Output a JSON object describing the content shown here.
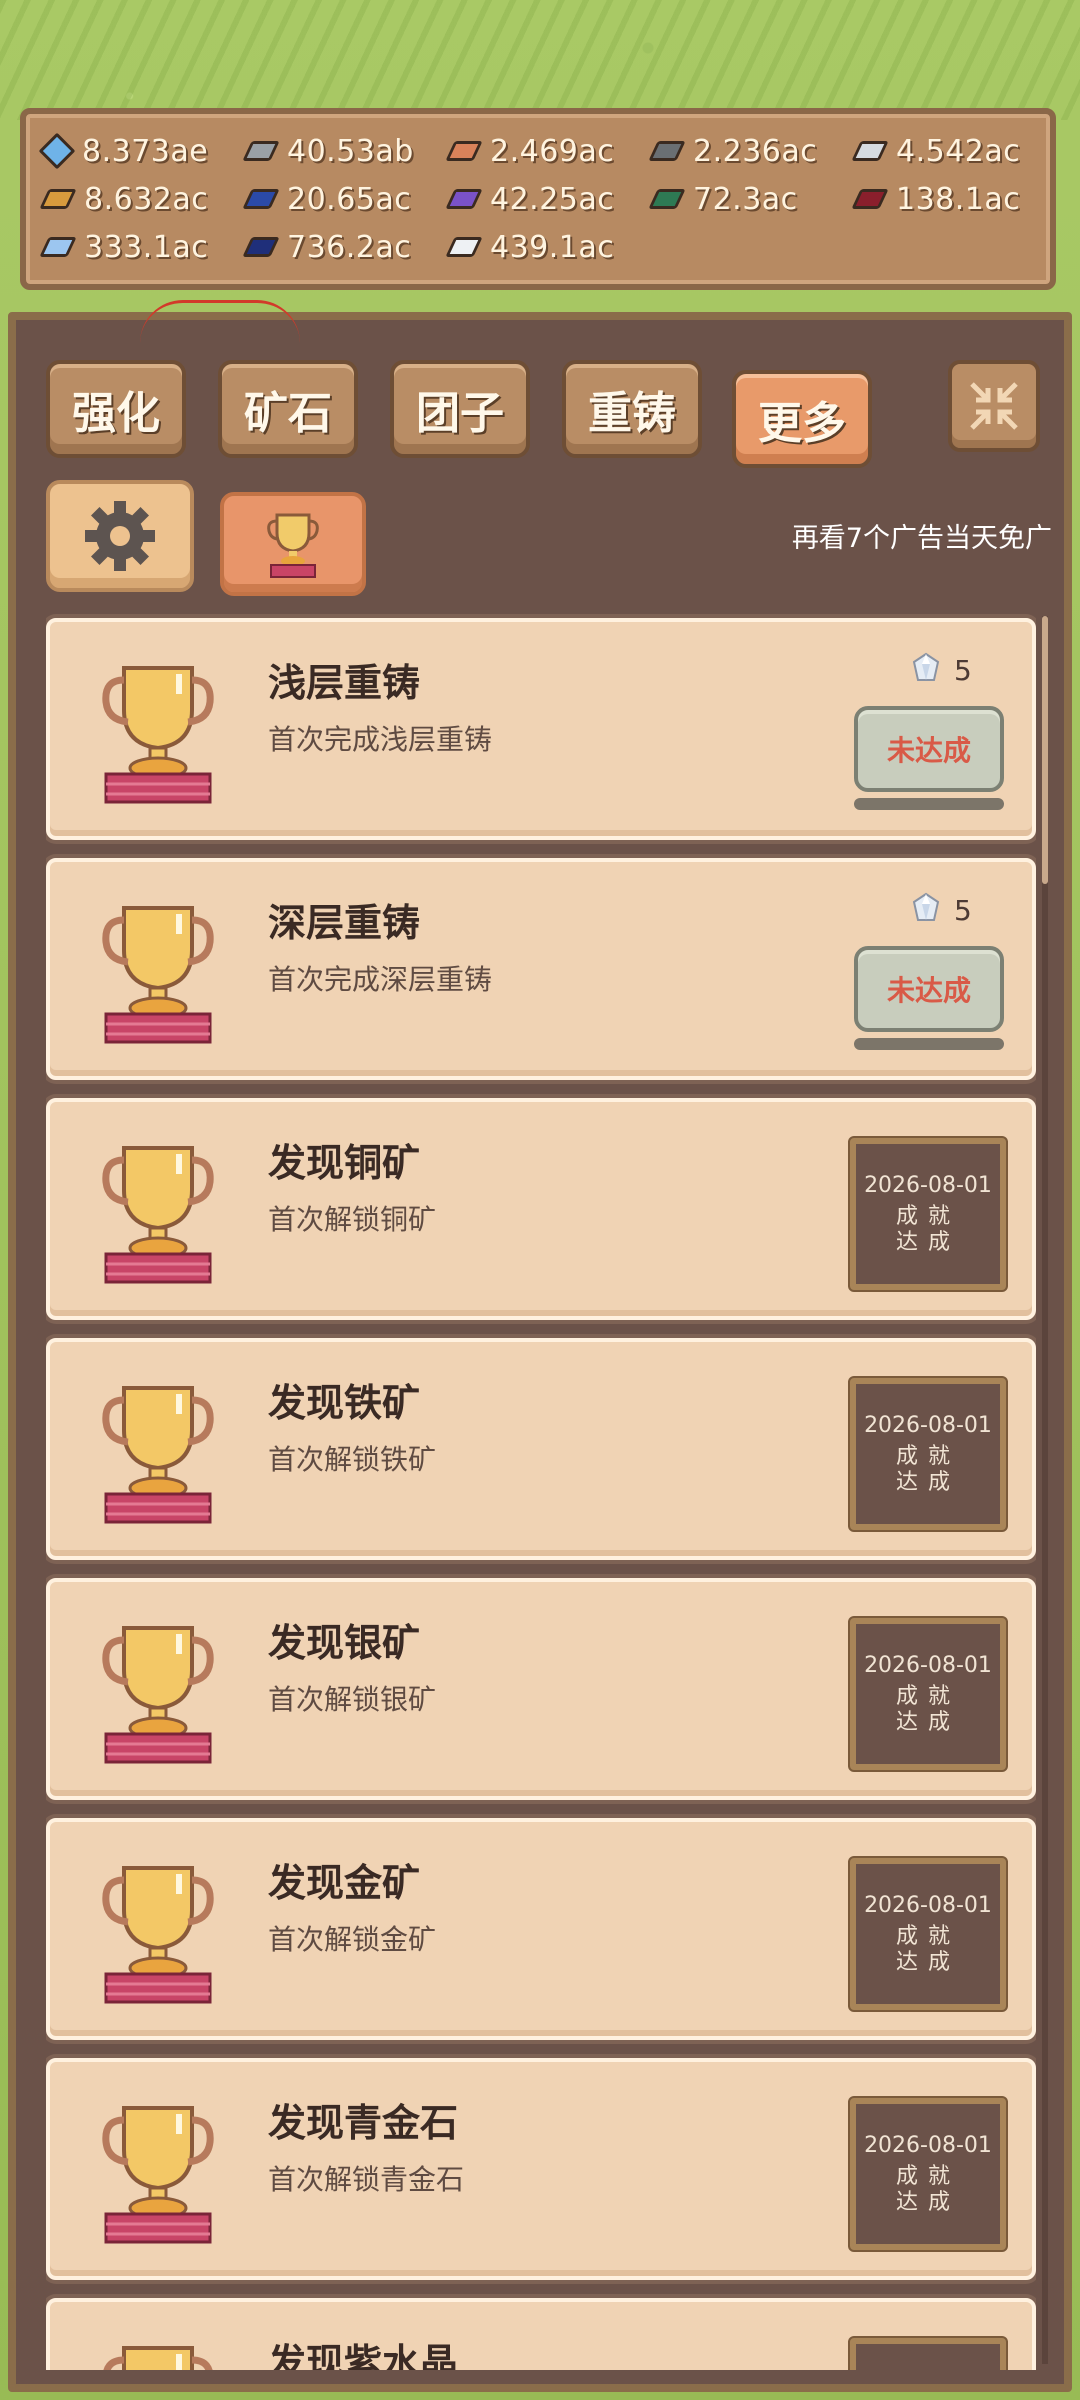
{
  "resources": [
    {
      "value": "8.373ae",
      "icon": "diamond-gem-icon",
      "color": "#6fb3e8"
    },
    {
      "value": "40.53ab",
      "icon": "grey-ore-icon",
      "color": "#9aa0a6"
    },
    {
      "value": "2.469ac",
      "icon": "copper-ore-icon",
      "color": "#d9825a"
    },
    {
      "value": "2.236ac",
      "icon": "iron-ore-icon",
      "color": "#6a6f73"
    },
    {
      "value": "4.542ac",
      "icon": "silver-ore-icon",
      "color": "#d6dbe0"
    },
    {
      "value": "8.632ac",
      "icon": "gold-ore-icon",
      "color": "#d79a3d"
    },
    {
      "value": "20.65ac",
      "icon": "blue-ore-icon",
      "color": "#2b4aa8"
    },
    {
      "value": "42.25ac",
      "icon": "amethyst-ore-icon",
      "color": "#7a52c8"
    },
    {
      "value": "72.3ac",
      "icon": "green-ore-icon",
      "color": "#2e7a54"
    },
    {
      "value": "138.1ac",
      "icon": "ruby-ore-icon",
      "color": "#8a1f2c"
    },
    {
      "value": "333.1ac",
      "icon": "crystal-ore-icon",
      "color": "#9cc6f0"
    },
    {
      "value": "736.2ac",
      "icon": "sapphire-ore-icon",
      "color": "#1f2f7a"
    },
    {
      "value": "439.1ac",
      "icon": "white-ore-icon",
      "color": "#eef1f4"
    }
  ],
  "tabs": [
    "强化",
    "矿石",
    "团子",
    "重铸",
    "更多"
  ],
  "active_tab": "更多",
  "ad_text": "再看7个广告当天免广",
  "achievements": [
    {
      "title": "浅层重铸",
      "desc": "首次完成浅层重铸",
      "status": "locked",
      "reward": "5",
      "button": "未达成"
    },
    {
      "title": "深层重铸",
      "desc": "首次完成深层重铸",
      "status": "locked",
      "reward": "5",
      "button": "未达成"
    },
    {
      "title": "发现铜矿",
      "desc": "首次解锁铜矿",
      "status": "done",
      "date": "2026-08-01",
      "done_label": "成就达成"
    },
    {
      "title": "发现铁矿",
      "desc": "首次解锁铁矿",
      "status": "done",
      "date": "2026-08-01",
      "done_label": "成就达成"
    },
    {
      "title": "发现银矿",
      "desc": "首次解锁银矿",
      "status": "done",
      "date": "2026-08-01",
      "done_label": "成就达成"
    },
    {
      "title": "发现金矿",
      "desc": "首次解锁金矿",
      "status": "done",
      "date": "2026-08-01",
      "done_label": "成就达成"
    },
    {
      "title": "发现青金石",
      "desc": "首次解锁青金石",
      "status": "done",
      "date": "2026-08-01",
      "done_label": "成就达成"
    },
    {
      "title": "发现紫水晶",
      "desc": "",
      "status": "done",
      "date": "",
      "done_label": ""
    }
  ]
}
